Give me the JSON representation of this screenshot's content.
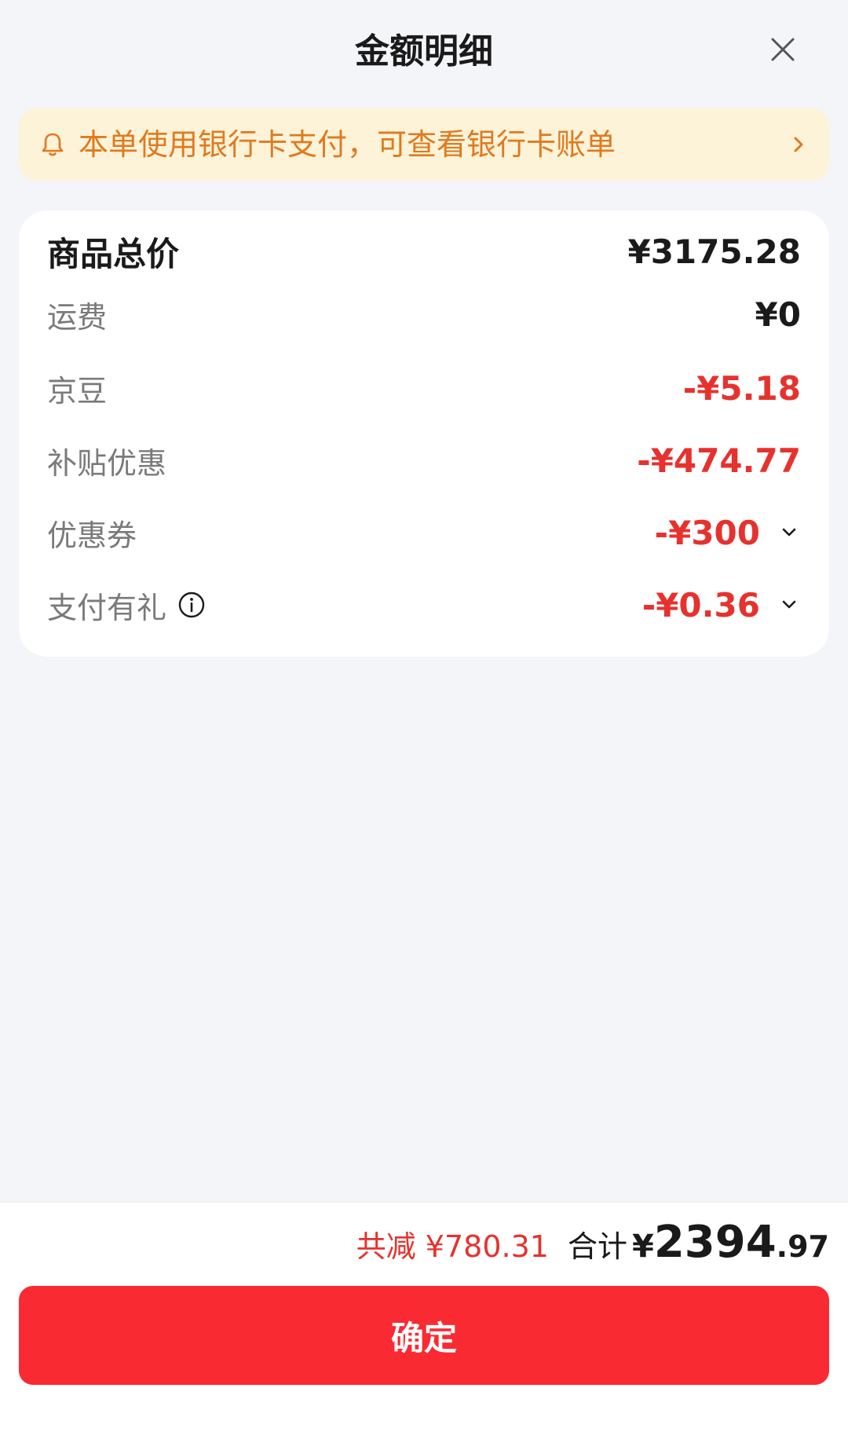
{
  "header": {
    "title": "金额明细",
    "close_icon": "close-icon"
  },
  "notice": {
    "icon": "bell-icon",
    "text": "本单使用银行卡支付，可查看银行卡账单",
    "color": "#e07a1f",
    "background": "#fdf3d8"
  },
  "breakdown": {
    "items": [
      {
        "label": "商品总价",
        "value": "¥3175.28"
      },
      {
        "label": "运费",
        "value": "¥0"
      },
      {
        "label": "京豆",
        "value": "-¥5.18"
      },
      {
        "label": "补贴优惠",
        "value": "-¥474.77"
      },
      {
        "label": "优惠券",
        "value": "-¥300"
      },
      {
        "label": "支付有礼",
        "value": "-¥0.36"
      }
    ]
  },
  "footer": {
    "reduced_text": "共减 ¥780.31",
    "total_label": "合计",
    "currency": "¥",
    "total_int": "2394",
    "total_dec": ".97",
    "confirm_label": "确定"
  },
  "colors": {
    "accent_red": "#e6322e",
    "button_red": "#fa2a32",
    "page_bg": "#f4f5f9"
  }
}
